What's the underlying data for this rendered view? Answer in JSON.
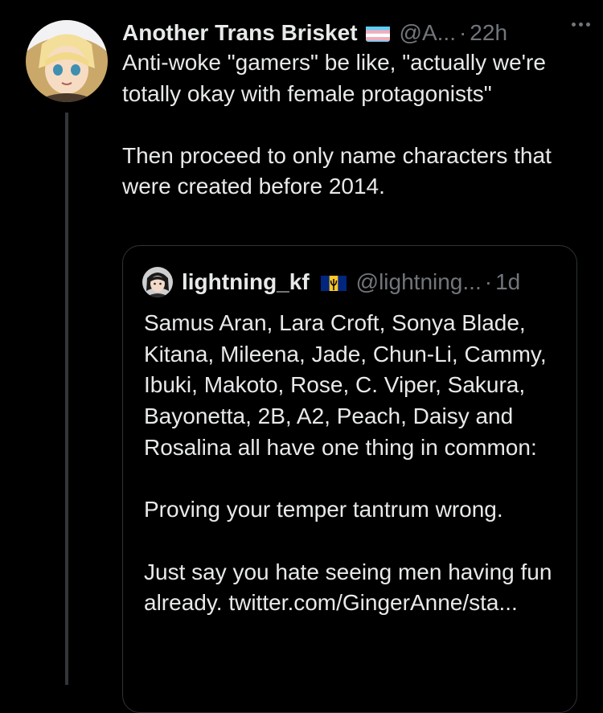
{
  "tweet": {
    "display_name": "Another Trans Brisket",
    "handle": "@A...",
    "separator": "·",
    "time": "22h",
    "text": "Anti-woke \"gamers\" be like, \"actually we're totally okay with female protagonists\"\n\nThen proceed to only name characters that were created before 2014.",
    "flag_icon": "transgender-flag-icon",
    "more_icon": "more-options-icon"
  },
  "quote": {
    "display_name": "lightning_kf",
    "handle": "@lightning...",
    "separator": "·",
    "time": "1d",
    "text": "Samus Aran, Lara Croft, Sonya Blade, Kitana, Mileena, Jade, Chun-Li, Cammy, Ibuki, Makoto, Rose, C. Viper, Sakura, Bayonetta, 2B, A2, Peach, Daisy and Rosalina all have one thing in common:\n\nProving your temper tantrum wrong.\n\nJust say you hate seeing men having fun already. twitter.com/GingerAnne/sta...",
    "flag_icon": "barbados-flag-icon"
  },
  "colors": {
    "background": "#000000",
    "primary_text": "#e7e9ea",
    "secondary_text": "#71767b",
    "border": "#2f3336"
  }
}
